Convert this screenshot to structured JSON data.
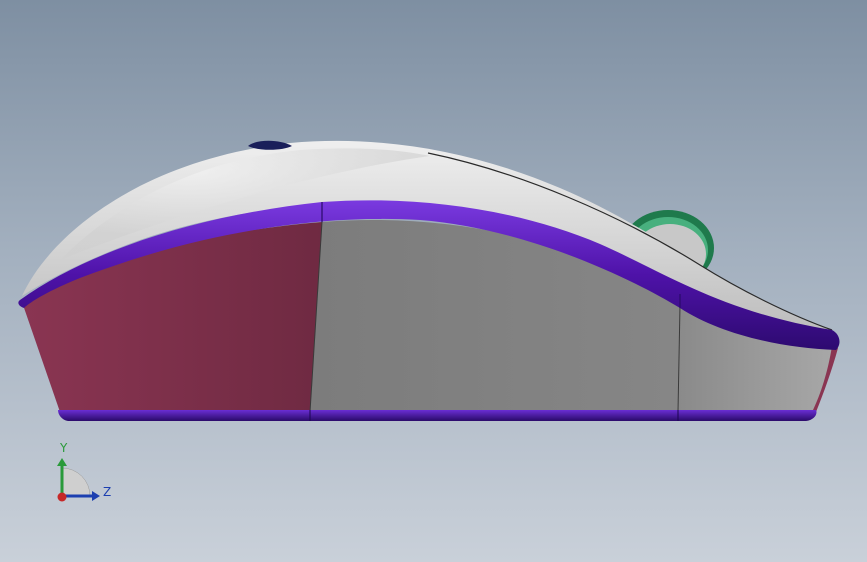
{
  "viewport": {
    "background_top": "#7e8fa2",
    "background_bottom": "#c9d0d9"
  },
  "model": {
    "name": "mouse",
    "colors": {
      "shell": "#d4d4d4",
      "trim": "#5a17b8",
      "side_panel_rear": "#7a3048",
      "side_panel_mid": "#7f7f7f",
      "side_panel_front": "#8e8e8e",
      "scroll_wheel": "#2e9a62"
    }
  },
  "triad": {
    "axis_y": "Y",
    "axis_z": "Z",
    "colors": {
      "y": "#2a9a3a",
      "z": "#1c3fb0",
      "x": "#c62828"
    }
  }
}
